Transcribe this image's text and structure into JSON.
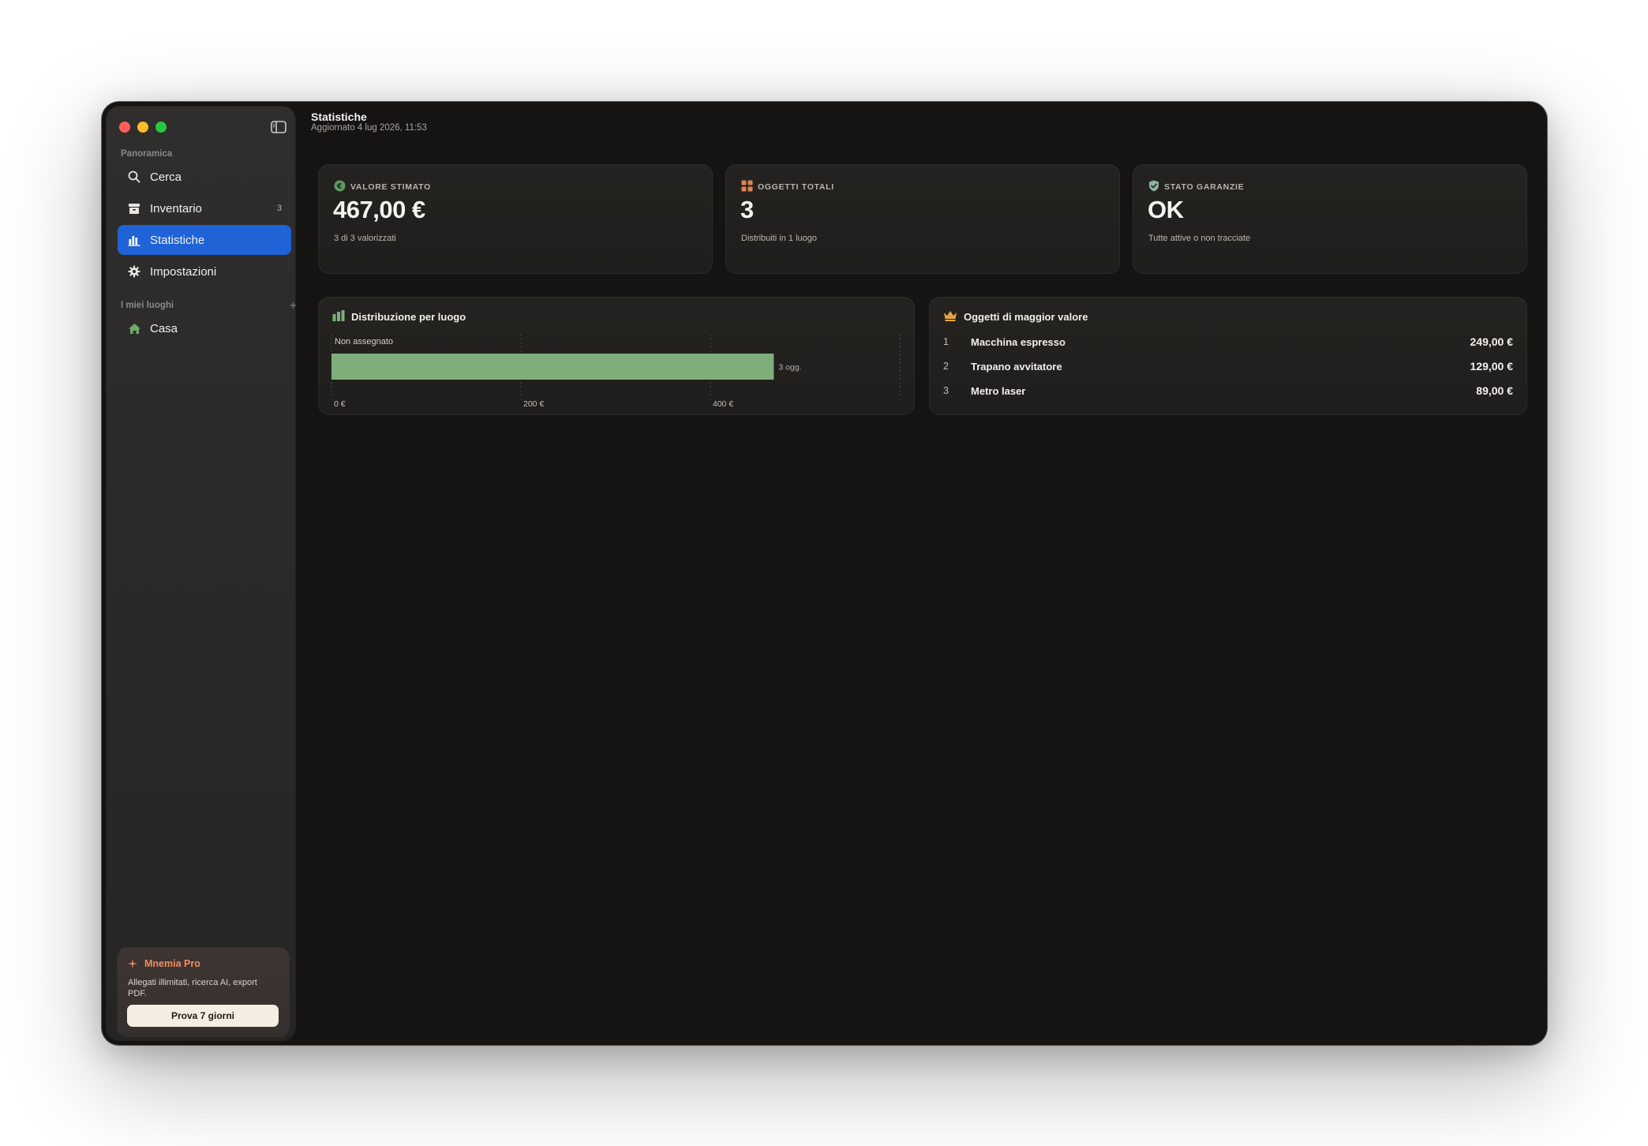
{
  "sidebar": {
    "overview_label": "Panoramica",
    "items": [
      {
        "label": "Cerca",
        "icon": "search-icon"
      },
      {
        "label": "Inventario",
        "icon": "archive-box-icon",
        "count": "3"
      },
      {
        "label": "Statistiche",
        "icon": "bar-chart-icon",
        "active": true
      },
      {
        "label": "Impostazioni",
        "icon": "gear-icon"
      }
    ],
    "places_label": "I miei luoghi",
    "add_place": "+",
    "places": [
      {
        "label": "Casa",
        "icon": "house-icon"
      }
    ],
    "promo": {
      "title": "Mnemia Pro",
      "description": "Allegati illimitati, ricerca AI, export PDF.",
      "button": "Prova 7 giorni"
    }
  },
  "header": {
    "title": "Statistiche",
    "updated": "Aggiornato 4 lug 2026, 11:53"
  },
  "stats": [
    {
      "label": "VALORE STIMATO",
      "value": "467,00 €",
      "caption": "3 di 3 valorizzati",
      "icon": "euro-icon"
    },
    {
      "label": "OGGETTI TOTALI",
      "value": "3",
      "caption": "Distribuiti in 1 luogo",
      "icon": "grid-icon"
    },
    {
      "label": "STATO GARANZIE",
      "value": "OK",
      "caption": "Tutte attive o non tracciate",
      "icon": "shield-check-icon"
    }
  ],
  "distribution": {
    "title": "Distribuzione per luogo",
    "icon": "bar-chart-icon"
  },
  "chart_data": {
    "type": "bar",
    "orientation": "horizontal",
    "categories": [
      "Non assegnato"
    ],
    "values": [
      467
    ],
    "data_labels": [
      "3 ogg."
    ],
    "xlim": [
      0,
      600
    ],
    "x_ticks": [
      "0 €",
      "200 €",
      "400 €"
    ],
    "x_tick_values": [
      0,
      200,
      400
    ],
    "bar_color": "#7fae7b",
    "grid": true
  },
  "top_items": {
    "title": "Oggetti di maggior valore",
    "icon": "crown-icon",
    "rows": [
      {
        "rank": "1",
        "name": "Macchina espresso",
        "value": "249,00 €"
      },
      {
        "rank": "2",
        "name": "Trapano avvitatore",
        "value": "129,00 €"
      },
      {
        "rank": "3",
        "name": "Metro laser",
        "value": "89,00 €"
      }
    ]
  },
  "colors": {
    "accent": "#1f63d6",
    "promo": "#f28c5f",
    "bar": "#7fae7b",
    "background": "#161412"
  }
}
